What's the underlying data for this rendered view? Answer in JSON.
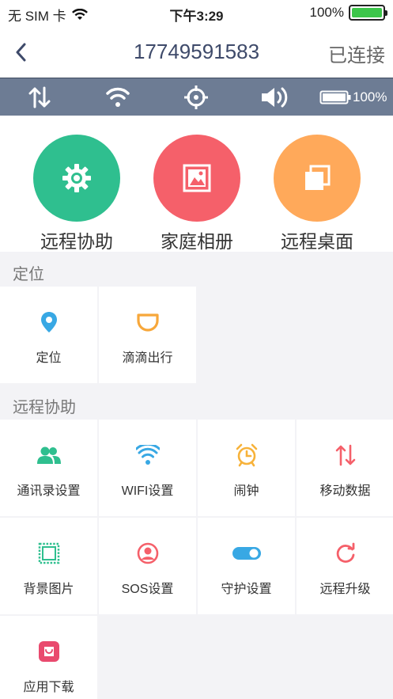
{
  "status_bar": {
    "carrier": "无 SIM 卡",
    "time": "下午3:29",
    "battery": "100%"
  },
  "nav": {
    "title": "17749591583",
    "right": "已连接"
  },
  "device_bar": {
    "battery_pct": "100%"
  },
  "quick": [
    {
      "label": "远程协助",
      "color": "#2fbf8f",
      "icon": "gear-icon"
    },
    {
      "label": "家庭相册",
      "color": "#f5606a",
      "icon": "picture-icon"
    },
    {
      "label": "远程桌面",
      "color": "#ffa95a",
      "icon": "windows-icon"
    }
  ],
  "sections": {
    "location": {
      "title": "定位",
      "items": [
        {
          "label": "定位",
          "icon": "location-pin-icon",
          "color": "#38a8e4"
        },
        {
          "label": "滴滴出行",
          "icon": "didi-icon",
          "color": "#f7a73a"
        }
      ]
    },
    "remote": {
      "title": "远程协助",
      "items": [
        {
          "label": "通讯录设置",
          "icon": "contacts-icon",
          "color": "#2fbf8f"
        },
        {
          "label": "WIFI设置",
          "icon": "wifi-icon",
          "color": "#38a8e4"
        },
        {
          "label": "闹钟",
          "icon": "alarm-icon",
          "color": "#f7b23a"
        },
        {
          "label": "移动数据",
          "icon": "mobile-data-icon",
          "color": "#f5606a"
        },
        {
          "label": "背景图片",
          "icon": "wallpaper-icon",
          "color": "#2fbf8f"
        },
        {
          "label": "SOS设置",
          "icon": "sos-icon",
          "color": "#f5606a"
        },
        {
          "label": "守护设置",
          "icon": "toggle-icon",
          "color": "#38a8e4"
        },
        {
          "label": "远程升级",
          "icon": "refresh-icon",
          "color": "#f5606a"
        },
        {
          "label": "应用下载",
          "icon": "app-store-icon",
          "color": "#e94a6e"
        }
      ]
    }
  }
}
